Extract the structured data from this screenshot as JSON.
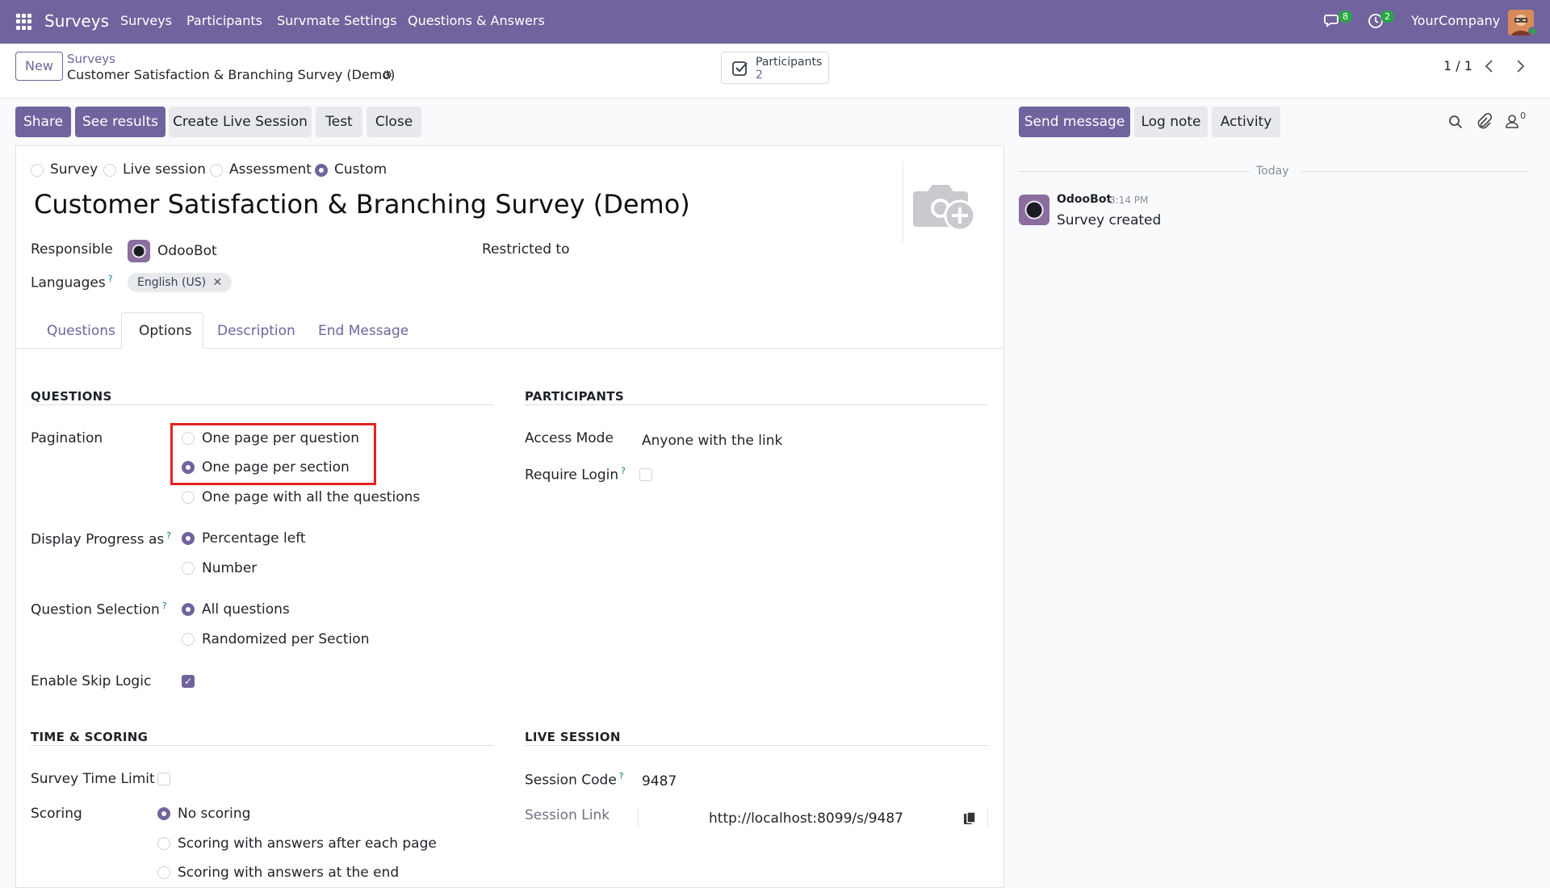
{
  "navbar": {
    "app_name": "Surveys",
    "menu": [
      "Surveys",
      "Participants",
      "Survmate Settings",
      "Questions & Answers"
    ],
    "messages_badge": "8",
    "activities_badge": "2",
    "company": "YourCompany",
    "colors": {
      "brand": "#71639e",
      "badge": "#28a745"
    }
  },
  "control": {
    "new_label": "New",
    "breadcrumb_parent": "Surveys",
    "breadcrumb_current": "Customer Satisfaction & Branching Survey (Demo)",
    "smart_button": {
      "label": "Participants",
      "value": "2"
    },
    "pager": "1 / 1"
  },
  "actions": {
    "share": "Share",
    "see_results": "See results",
    "create_live_session": "Create Live Session",
    "test": "Test",
    "close": "Close"
  },
  "form": {
    "survey_types": [
      "Survey",
      "Live session",
      "Assessment",
      "Custom"
    ],
    "survey_type_selected": "Custom",
    "title": "Customer Satisfaction & Branching Survey (Demo)",
    "responsible_label": "Responsible",
    "responsible_value": "OdooBot",
    "restricted_label": "Restricted to",
    "languages_label": "Languages",
    "languages_tag": "English (US)",
    "tabs": [
      "Questions",
      "Options",
      "Description",
      "End Message"
    ],
    "active_tab": "Options"
  },
  "questions_section": {
    "title": "QUESTIONS",
    "pagination_label": "Pagination",
    "pagination_options": [
      "One page per question",
      "One page per section",
      "One page with all the questions"
    ],
    "pagination_selected": "One page per section",
    "progress_label": "Display Progress as",
    "progress_options": [
      "Percentage left",
      "Number"
    ],
    "progress_selected": "Percentage left",
    "selection_label": "Question Selection",
    "selection_options": [
      "All questions",
      "Randomized per Section"
    ],
    "selection_selected": "All questions",
    "skip_logic_label": "Enable Skip Logic",
    "skip_logic_checked": true
  },
  "participants_section": {
    "title": "PARTICIPANTS",
    "access_mode_label": "Access Mode",
    "access_mode_value": "Anyone with the link",
    "require_login_label": "Require Login",
    "require_login_checked": false
  },
  "time_section": {
    "title": "TIME & SCORING",
    "time_limit_label": "Survey Time Limit",
    "scoring_label": "Scoring",
    "scoring_options": [
      "No scoring",
      "Scoring with answers after each page",
      "Scoring with answers at the end"
    ],
    "scoring_selected": "No scoring"
  },
  "live_section": {
    "title": "LIVE SESSION",
    "session_code_label": "Session Code",
    "session_code_value": "9487",
    "session_link_label": "Session Link",
    "session_link_value": "http://localhost:8099/s/9487"
  },
  "chatter": {
    "send_message": "Send message",
    "log_note": "Log note",
    "activity": "Activity",
    "followers_count": "0",
    "date_separator": "Today",
    "message": {
      "author": "OdooBot",
      "time": "3:14 PM",
      "body": "Survey created"
    }
  }
}
